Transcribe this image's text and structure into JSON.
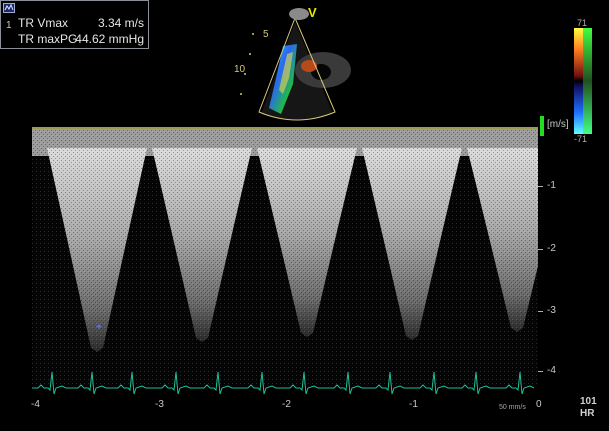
{
  "measurement": {
    "index": "1",
    "rows": [
      {
        "label": "TR Vmax",
        "value": "3.34 m/s"
      },
      {
        "label": "TR maxPG",
        "value": "44.62 mmHg"
      }
    ]
  },
  "thumbnail": {
    "depth_labels": [
      "5",
      "10"
    ],
    "probe_marker": "V"
  },
  "color_scale": {
    "top": "71",
    "bottom": "-71"
  },
  "spectral": {
    "unit": "[m/s]",
    "y_ticks": [
      "-1",
      "-2",
      "-3",
      "-4"
    ],
    "y_values": [
      -1,
      -2,
      -3,
      -4
    ],
    "x_ticks": [
      "-4",
      "-3",
      "-2",
      "-1",
      "0"
    ],
    "sweep_speed": "50 mm/s"
  },
  "heart_rate": {
    "value": "101",
    "label": "HR"
  },
  "colors": {
    "baseline": "#9a9a55",
    "scale_marker": "#22dd22",
    "ecg": "#1fbf9a",
    "probe_marker": "#e8e600"
  }
}
